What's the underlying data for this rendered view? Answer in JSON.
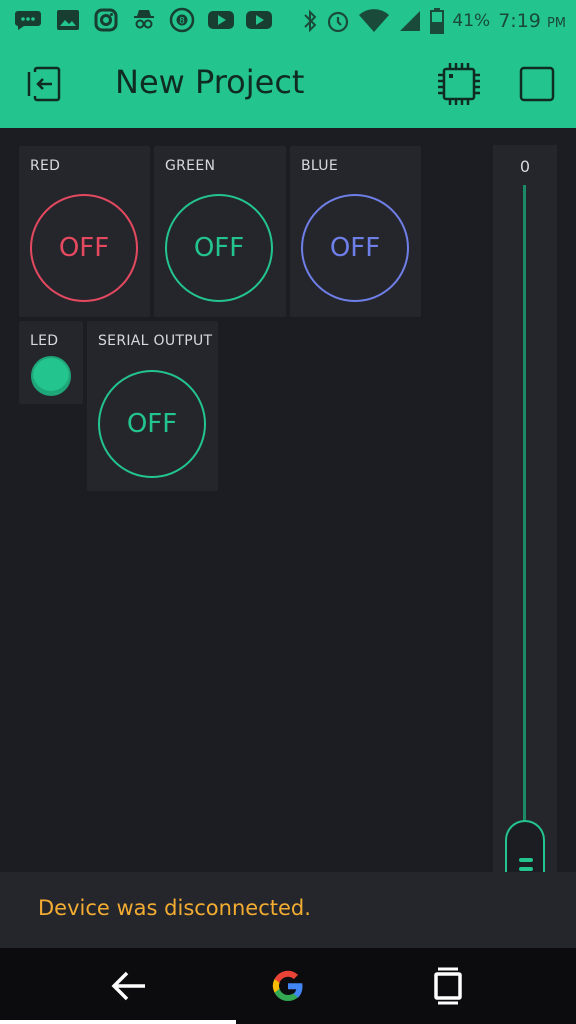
{
  "status_bar": {
    "battery": "41%",
    "time": "7:19",
    "ampm": "PM",
    "icons": [
      "messages-icon",
      "gallery-icon",
      "instagram-icon",
      "incognito-icon",
      "pool-8ball-icon",
      "youtube-icon",
      "youtube-icon",
      "bluetooth-icon",
      "alarm-icon",
      "wifi-icon",
      "signal-icon",
      "battery-icon"
    ]
  },
  "app_bar": {
    "title": "New Project",
    "back_icon": "exit-project-icon",
    "device_icon": "chip-icon",
    "play_icon": "stop-square-icon"
  },
  "widgets": {
    "red": {
      "label": "RED",
      "state": "OFF",
      "color": "#e54960"
    },
    "green": {
      "label": "GREEN",
      "state": "OFF",
      "color": "#23c48e"
    },
    "blue": {
      "label": "BLUE",
      "state": "OFF",
      "color": "#6f7fe8"
    },
    "led": {
      "label": "LED",
      "color": "#23c48e"
    },
    "serial": {
      "label": "SERIAL OUTPUT",
      "state": "OFF",
      "color": "#23c48e"
    }
  },
  "slider": {
    "value": "0",
    "level": 0
  },
  "toast": {
    "message": "Device was disconnected."
  },
  "colors": {
    "accent": "#23c48e",
    "background": "#1c1d22",
    "widget_bg": "#25262c",
    "toast_text": "#f2ac32"
  },
  "nav_bar": {
    "back_icon": "back-arrow-icon",
    "home_icon": "google-g-icon",
    "recents_icon": "recents-icon"
  }
}
